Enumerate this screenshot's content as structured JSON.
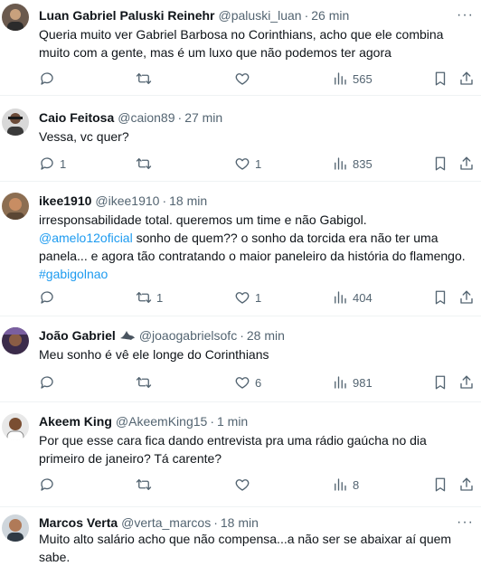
{
  "tweets": [
    {
      "name": "Luan Gabriel Paluski Reinehr",
      "handle": "@paluski_luan",
      "time": "26 min",
      "text": "Queria muito ver Gabriel Barbosa no Corinthians, acho que ele combina muito com a gente, mas é um luxo que não podemos ter agora",
      "replies": "",
      "retweets": "",
      "likes": "",
      "views": "565"
    },
    {
      "name": "Caio Feitosa",
      "handle": "@caion89",
      "time": "27 min",
      "text": "Vessa, vc quer?",
      "replies": "1",
      "retweets": "",
      "likes": "1",
      "views": "835"
    },
    {
      "name": "ikee1910",
      "handle": "@ikee1910",
      "time": "18 min",
      "text_line1": "irresponsabilidade total. queremos um time e não Gabigol.",
      "mention": "@amelo12oficial",
      "text_line2_rest": " sonho de quem?? o sonho da torcida era não ter uma panela... e agora tão contratando o maior paneleiro da história do flamengo.",
      "hashtag": "#gabigolnao",
      "replies": "",
      "retweets": "1",
      "likes": "1",
      "views": "404"
    },
    {
      "name": "João Gabriel",
      "handle": "@joaogabrielsofc",
      "time": "28 min",
      "text": "Meu sonho é vê ele longe do Corinthians",
      "replies": "",
      "retweets": "",
      "likes": "6",
      "views": "981"
    },
    {
      "name": "Akeem King",
      "handle": "@AkeemKing15",
      "time": "1 min",
      "text": "Por que esse cara fica dando entrevista pra uma rádio gaúcha no dia primeiro de janeiro? Tá carente?",
      "replies": "",
      "retweets": "",
      "likes": "",
      "views": "8"
    },
    {
      "name": "Marcos Verta",
      "handle": "@verta_marcos",
      "time": "18 min",
      "text": "Muito alto salário acho que não compensa...a não ser se abaixar aí quem sabe."
    }
  ],
  "separator": "·",
  "more_label": "···",
  "icons": {
    "reply": "reply-icon",
    "retweet": "retweet-icon",
    "like": "heart-icon",
    "views": "views-icon",
    "bookmark": "bookmark-icon",
    "share": "share-icon"
  }
}
